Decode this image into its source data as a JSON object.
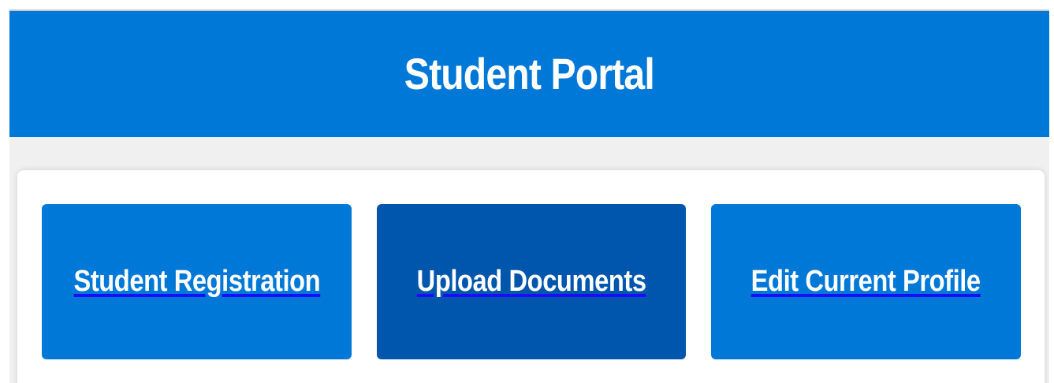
{
  "header": {
    "title": "Student Portal"
  },
  "tiles": [
    {
      "label": "Student Registration",
      "state": "default"
    },
    {
      "label": "Upload Documents",
      "state": "hover"
    },
    {
      "label": "Edit Current Profile",
      "state": "default"
    }
  ],
  "colors": {
    "primary": "#0078d7",
    "primary_dark": "#0055ac",
    "background": "#f0f0f0",
    "card": "#ffffff",
    "text_on_primary": "#ffffff",
    "link_underline": "#1a0dff"
  }
}
